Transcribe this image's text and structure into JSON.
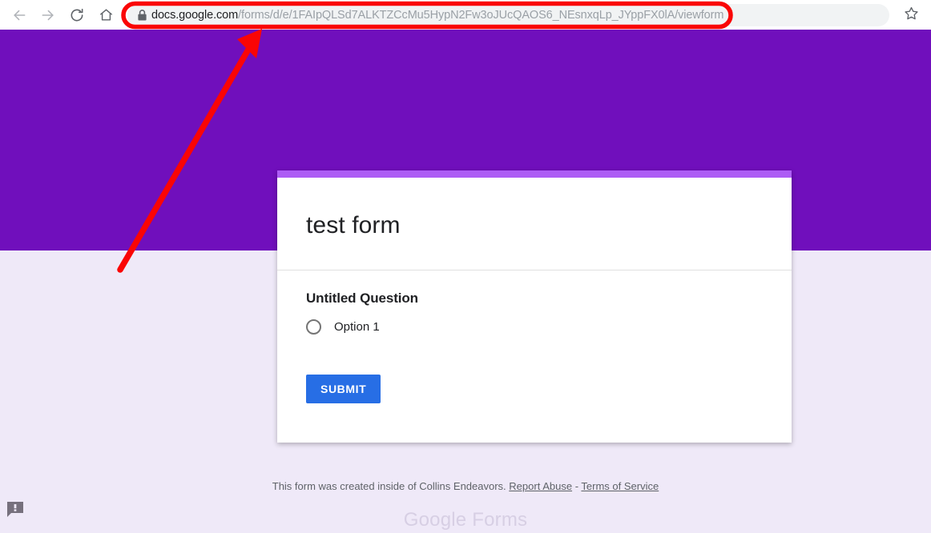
{
  "browser": {
    "back_icon": "arrow-left-icon",
    "forward_icon": "arrow-right-icon",
    "reload_icon": "reload-icon",
    "home_icon": "home-icon",
    "lock_icon": "lock-icon",
    "bookmark_icon": "star-icon",
    "url_host": "docs.google.com",
    "url_path": "/forms/d/e/1FAIpQLSd7ALKTZCcMu5HypN2Fw3oJUcQAOS6_NEsnxqLp_JYppFX0lA/viewform",
    "url_full": "docs.google.com/forms/d/e/1FAIpQLSd7ALKTZCcMu5HypN2Fw3oJUcQAOS6_NEsnxqLp_JYppFX0lA/viewform"
  },
  "form": {
    "title": "test form",
    "question_title": "Untitled Question",
    "options": [
      {
        "label": "Option 1",
        "selected": false
      }
    ],
    "submit_label": "SUBMIT"
  },
  "footer": {
    "notice": "This form was created inside of Collins Endeavors.",
    "report_abuse_label": "Report Abuse",
    "separator": "-",
    "terms_label": "Terms of Service",
    "brand_google": "Google",
    "brand_forms": " Forms"
  },
  "feedback": {
    "icon": "feedback-bubble-icon"
  },
  "annotations": {
    "url_highlight_shape": "red-oval",
    "pointer_shape": "red-arrow"
  },
  "colors": {
    "banner_purple": "#700fbc",
    "card_stripe_purple": "#ad5cf5",
    "page_background": "#efe9f8",
    "submit_blue": "#276ee5",
    "annotation_red": "#fa0505",
    "brand_gray": "#d7cfe4"
  }
}
